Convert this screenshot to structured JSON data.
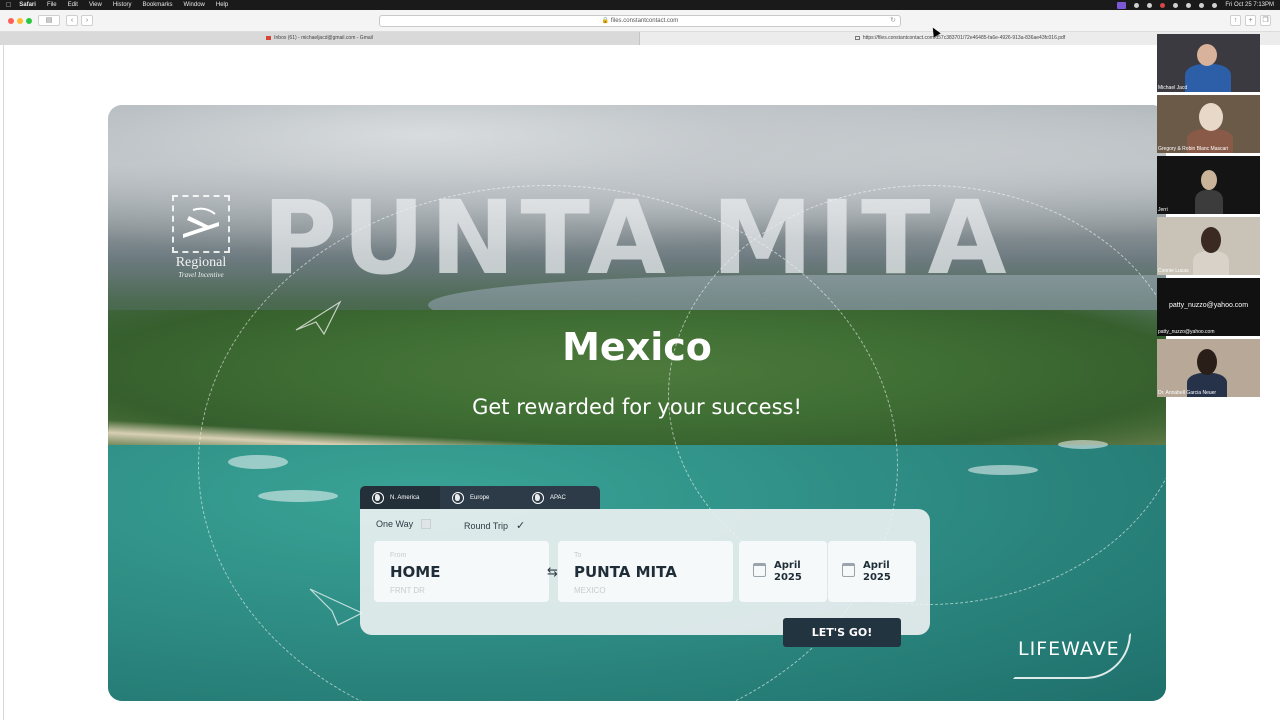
{
  "menubar": {
    "app": "Safari",
    "items": [
      "File",
      "Edit",
      "View",
      "History",
      "Bookmarks",
      "Window",
      "Help"
    ],
    "clock": "Fri Oct 25  7:13PM"
  },
  "browser": {
    "address": "files.constantcontact.com",
    "tabs": [
      {
        "label": "Inbox (61) - michaeljacd@gmail.com - Gmail"
      },
      {
        "label": "https://files.constantcontact.com/d57c383701/72e46485-fa6e-4926-913a-836ae43fc016.pdf"
      }
    ]
  },
  "flyer": {
    "logo_word": "Regional",
    "logo_sub": "Travel Incentive",
    "headline": "PUNTA MITA",
    "country": "Mexico",
    "tagline": "Get rewarded for your success!",
    "regions": [
      "N. America",
      "Europe",
      "APAC"
    ],
    "one_way": "One Way",
    "round_trip": "Round Trip",
    "from_label": "From",
    "from_value": "HOME",
    "from_hint": "FRNT DR",
    "to_label": "To",
    "to_value": "PUNTA MITA",
    "to_hint": "MEXICO",
    "date1_month": "April",
    "date1_year": "2025",
    "date2_month": "April",
    "date2_year": "2025",
    "cta": "LET'S GO!",
    "brand": "LIFEWAVE"
  },
  "participants": [
    {
      "name": "Michael Jacd"
    },
    {
      "name": "Gregory & Robin Blanc Mascari"
    },
    {
      "name": "Jerri"
    },
    {
      "name": "Connie Lucas"
    },
    {
      "name": "patty_nuzzo@yahoo.com",
      "email": "patty_nuzzo@yahoo.com"
    },
    {
      "name": "Dr. Annabell Garcia Neuer"
    }
  ]
}
